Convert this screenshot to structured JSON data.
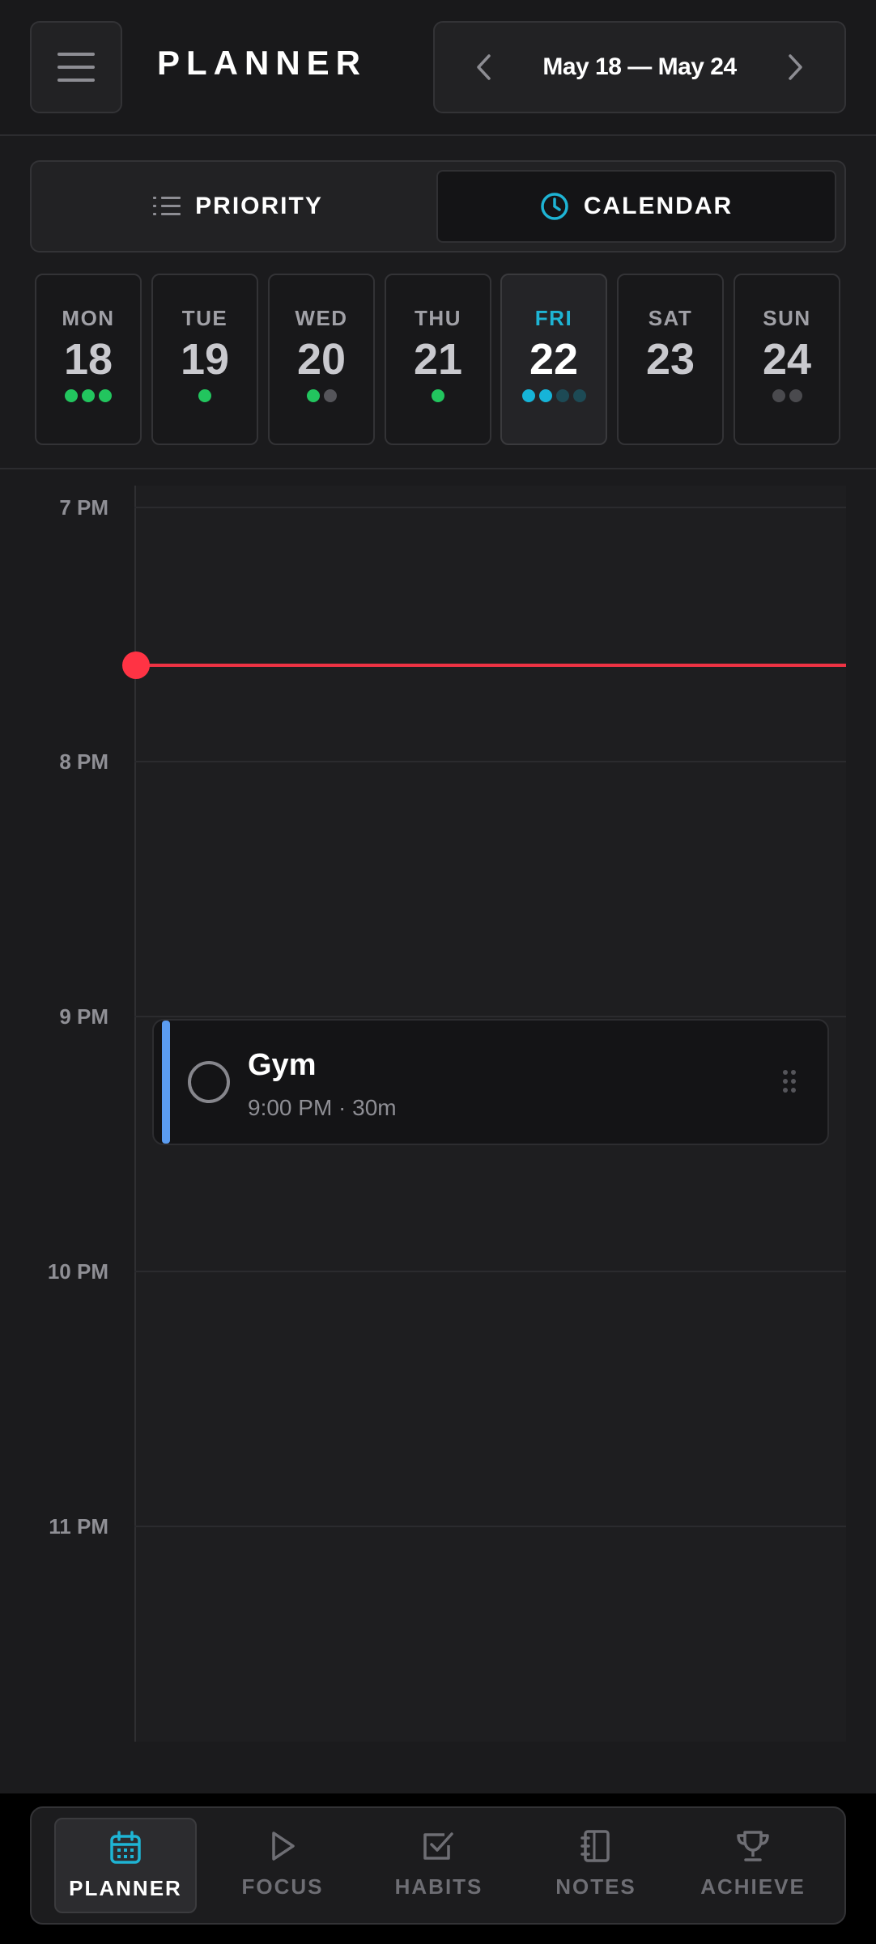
{
  "header": {
    "title": "PLANNER",
    "date_range": "May 18 — May 24"
  },
  "view_toggle": {
    "priority_label": "PRIORITY",
    "calendar_label": "CALENDAR",
    "selected": "calendar"
  },
  "week": {
    "days": [
      {
        "name": "MON",
        "num": "18",
        "dots": [
          "#22c55e",
          "#22c55e",
          "#22c55e"
        ]
      },
      {
        "name": "TUE",
        "num": "19",
        "dots": [
          "#22c55e"
        ]
      },
      {
        "name": "WED",
        "num": "20",
        "dots": [
          "#22c55e",
          "#55555a"
        ]
      },
      {
        "name": "THU",
        "num": "21",
        "dots": [
          "#22c55e"
        ]
      },
      {
        "name": "FRI",
        "num": "22",
        "dots": [
          "#16b4d8",
          "#16b4d8",
          "#1d4a55",
          "#1d4a55"
        ],
        "selected": true
      },
      {
        "name": "SAT",
        "num": "23",
        "dots": []
      },
      {
        "name": "SUN",
        "num": "24",
        "dots": [
          "#4a4a4e",
          "#4a4a4e"
        ]
      }
    ]
  },
  "timeline": {
    "hours": [
      "7 PM",
      "8 PM",
      "9 PM",
      "10 PM",
      "11 PM"
    ],
    "now_indicator_color": "#ee3344",
    "events": [
      {
        "title": "Gym",
        "meta": "9:00 PM · 30m",
        "accent": "#5b9cf0",
        "completed": false
      }
    ]
  },
  "bottom_nav": {
    "active": "planner",
    "items": [
      {
        "id": "planner",
        "label": "PLANNER",
        "icon": "calendar-icon"
      },
      {
        "id": "focus",
        "label": "FOCUS",
        "icon": "play-icon"
      },
      {
        "id": "habits",
        "label": "HABITS",
        "icon": "checkbox-icon"
      },
      {
        "id": "notes",
        "label": "NOTES",
        "icon": "notebook-icon"
      },
      {
        "id": "achieve",
        "label": "ACHIEVE",
        "icon": "trophy-icon"
      }
    ]
  },
  "colors": {
    "accent": "#1eb4d4",
    "background": "#1b1b1d",
    "now_line": "#ee3344"
  }
}
